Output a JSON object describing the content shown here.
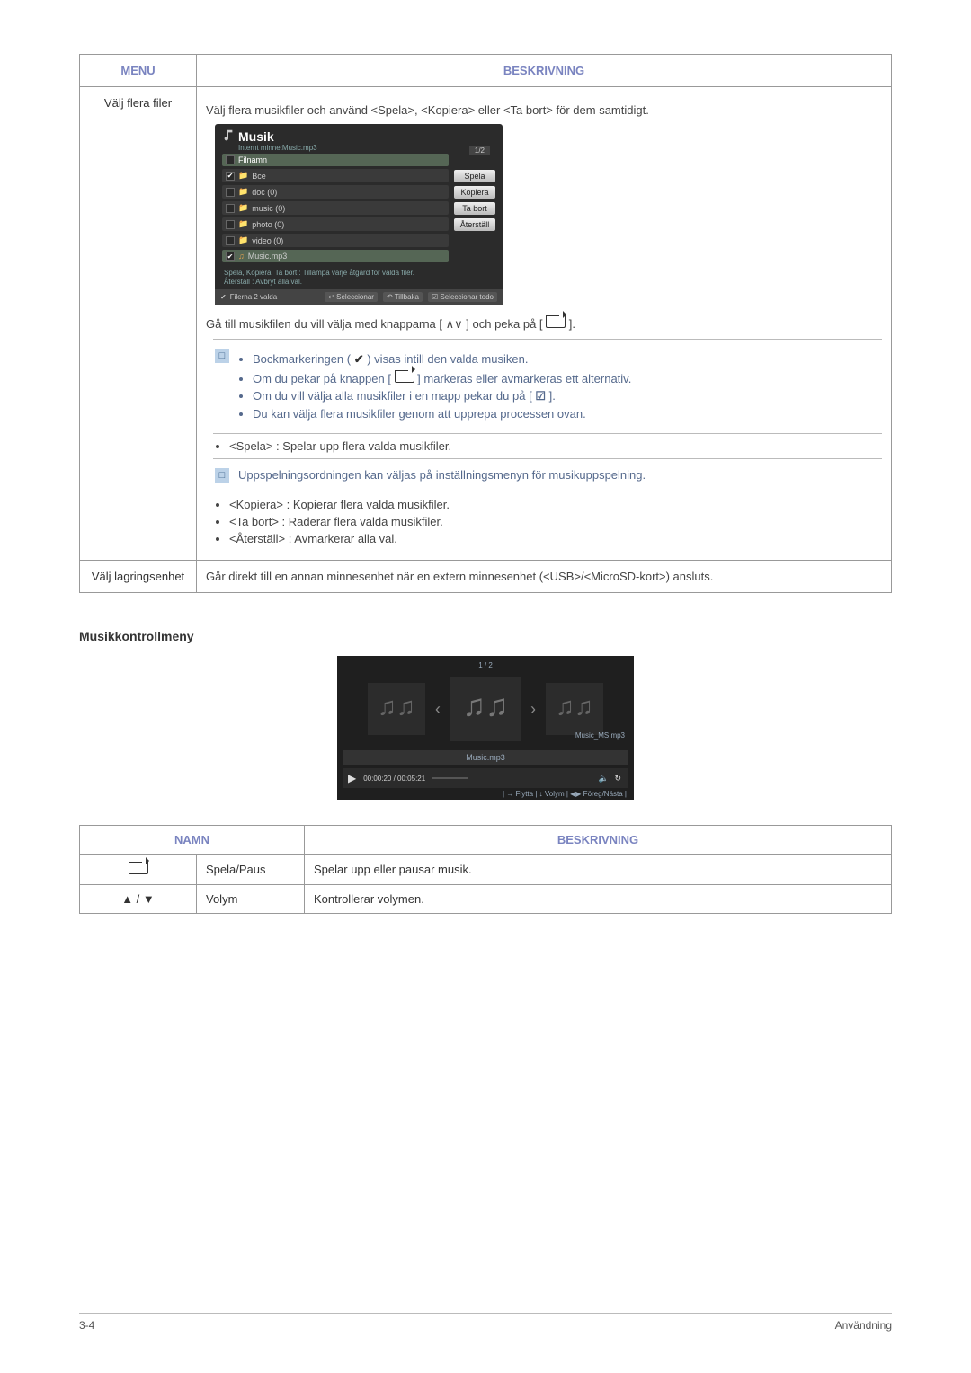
{
  "table1": {
    "hdr_menu": "MENU",
    "hdr_desc": "BESKRIVNING",
    "row1_left": "Välj flera filer",
    "row1_intro": "Välj flera musikfiler och använd <Spela>, <Kopiera> eller <Ta bort> för dem samtidigt.",
    "row1_para2_a": "Gå till musikfilen du vill välja med knapparna [ ",
    "row1_para2_b": " ] och peka på [ ",
    "row1_para2_c": " ].",
    "note1_li1_a": "Bockmarkeringen ( ",
    "note1_li1_b": " ) visas intill den valda musiken.",
    "note1_li2_a": "Om du pekar på knappen [ ",
    "note1_li2_b": " ] markeras eller avmarkeras ett alternativ.",
    "note1_li3_a": "Om du vill välja alla musikfiler i en mapp pekar du på [ ",
    "note1_li3_b": " ].",
    "note1_li4": "Du kan välja flera musikfiler genom att upprepa processen ovan.",
    "li_play": "<Spela> : Spelar upp flera valda musikfiler.",
    "note2_li": "Uppspelningsordningen kan väljas på inställningsmenyn för musikuppspelning.",
    "li_copy": "<Kopiera> : Kopierar flera valda musikfiler.",
    "li_del": "<Ta bort> : Raderar flera valda musikfiler.",
    "li_reset": "<Återställ> : Avmarkerar alla val.",
    "row2_left": "Välj lagringsenhet",
    "row2_desc": "Går direkt till en annan minnesenhet när en extern minnesenhet (<USB>/<MicroSD-kort>) ansluts."
  },
  "mock_music": {
    "title": "Musik",
    "sub": "Internt minne:Music.mp3",
    "pager": "1/2",
    "header_row": "Filnamn",
    "rows": [
      "Bce",
      "doc (0)",
      "music (0)",
      "photo (0)",
      "video (0)",
      "Music.mp3"
    ],
    "btn_play": "Spela",
    "btn_copy": "Kopiera",
    "btn_del": "Ta bort",
    "btn_reset": "Återställ",
    "hint": "Spela, Kopiera, Ta bort : Tillämpa varje åtgärd för valda filer.\nÅterställ : Avbryt alla val.",
    "footer_count": "Filerna 2 valda",
    "footer_sel": "Seleccionar",
    "footer_back": "Tillbaka",
    "footer_selall": "Seleccionar todo"
  },
  "section2_heading": "Musikkontrollmeny",
  "mock_player": {
    "top": "1 / 2",
    "caption_right": "Music_MS.mp3",
    "current": "Music.mp3",
    "time": "00:00:20 / 00:05:21",
    "footer": "|  → Flytta   |   ↕ Volym   |   ◀▶ Föreg/Nästa  |"
  },
  "table2": {
    "hdr_name": "NAMN",
    "hdr_desc": "BESKRIVNING",
    "r1_name": "Spela/Paus",
    "r1_desc": "Spelar upp eller pausar musik.",
    "r2_sym": "▲ / ▼",
    "r2_name": "Volym",
    "r2_desc": "Kontrollerar volymen."
  },
  "footer": {
    "left": "3-4",
    "right": "Användning"
  }
}
